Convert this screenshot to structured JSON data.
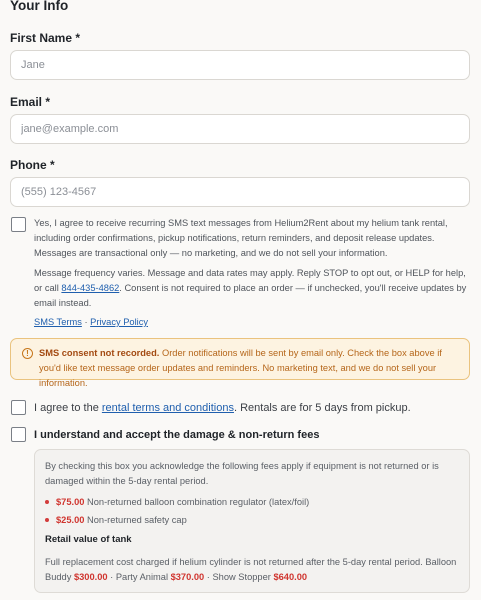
{
  "section": {
    "title": "Your Info"
  },
  "first_name": {
    "label": "First Name *",
    "placeholder": "Jane"
  },
  "email": {
    "label": "Email *",
    "placeholder": "jane@example.com"
  },
  "phone": {
    "label": "Phone *",
    "placeholder": "(555) 123-4567"
  },
  "sms_consent": {
    "paragraph1": "Yes, I agree to receive recurring SMS text messages from Helium2Rent about my helium tank rental, including order confirmations, pickup notifications, return reminders, and deposit release updates. Messages are transactional only — no marketing, and we do not sell your information.",
    "paragraph2_before": "Message frequency varies. Message and data rates may apply. Reply STOP to opt out, or HELP for help, or call ",
    "phone_link": "844-435-4862",
    "paragraph2_after": ". Consent is not required to place an order — if unchecked, you'll receive updates by email instead.",
    "sms_terms_link": "SMS Terms",
    "separator": " · ",
    "privacy_link": "Privacy Policy"
  },
  "alert": {
    "icon": "info-circle-icon",
    "strong": "SMS consent not recorded.",
    "text": " Order notifications will be sent by email only. Check the box above if you'd like text message order updates and reminders. No marketing text, and we do not sell your information.",
    "color": "#b5661a",
    "background": "#fdf3e1"
  },
  "rental_terms": {
    "before": "I agree to the ",
    "link": "rental terms and conditions",
    "after": ". Rentals are for 5 days from pickup."
  },
  "damage_fees": {
    "label": "I understand and accept the damage & non-return fees",
    "intro": "By checking this box you acknowledge the following fees apply if equipment is not returned or is damaged within the 5-day rental period.",
    "fees": [
      {
        "price": "$75.00",
        "desc": " Non-returned balloon combination regulator (latex/foil)"
      },
      {
        "price": "$25.00",
        "desc": " Non-returned safety cap"
      }
    ],
    "retail_title": "Retail value of tank",
    "retail_text": "Full replacement cost charged if helium cylinder is not returned after the 5-day rental period. Balloon Buddy ",
    "tanks": [
      {
        "price": "$300.00",
        "sep": " · Party Animal "
      },
      {
        "price": "$370.00",
        "sep": " · Show Stopper "
      },
      {
        "price": "$640.00",
        "sep": ""
      }
    ]
  },
  "colors": {
    "accent_link": "#1f5fae",
    "price_red": "#d0352f"
  }
}
